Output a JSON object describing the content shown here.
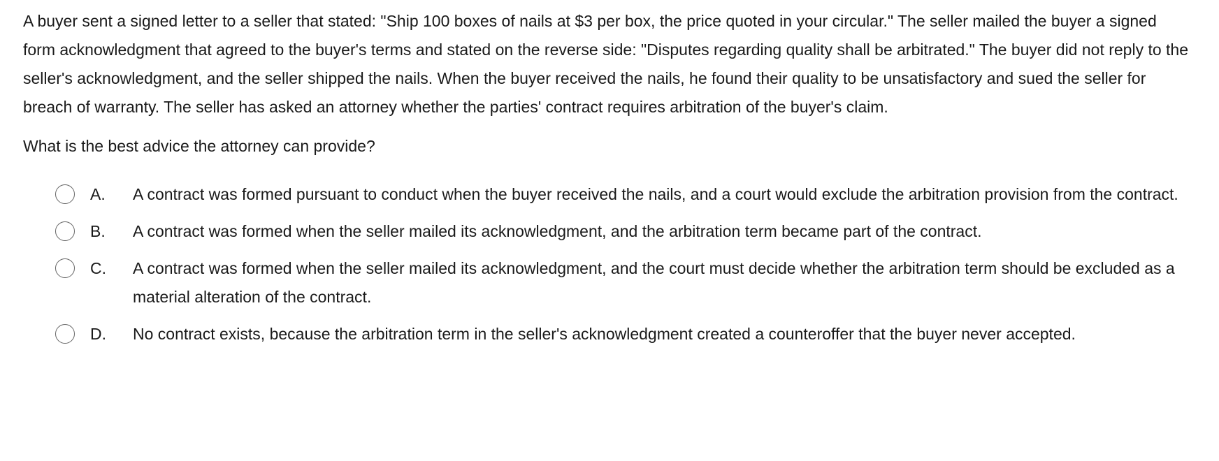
{
  "stem": "A buyer sent a signed letter to a seller that stated: \"Ship 100 boxes of nails at $3 per box, the price quoted in your circular.\"  The seller mailed the buyer a signed form acknowledgment that agreed to the buyer's terms and stated on the reverse side: \"Disputes regarding quality shall be arbitrated.\"  The buyer did not reply to the seller's acknowledgment, and the seller shipped the nails.  When the buyer received the nails, he found their quality to be unsatisfactory and sued the seller for breach of warranty.  The seller has asked an attorney whether the parties' contract requires arbitration of the buyer's claim.",
  "question": "What is the best advice the attorney can provide?",
  "choices": [
    {
      "letter": "A.",
      "text": "A contract was formed pursuant to conduct when the buyer received the nails, and a court would exclude the arbitration provision from the contract."
    },
    {
      "letter": "B.",
      "text": "A contract was formed when the seller mailed its acknowledgment, and the arbitration term became part of the contract."
    },
    {
      "letter": "C.",
      "text": "A contract was formed when the seller mailed its acknowledgment, and the court must decide whether the arbitration term should be excluded as a material alteration of the contract."
    },
    {
      "letter": "D.",
      "text": "No contract exists, because the arbitration term in the seller's acknowledgment created a counteroffer that the buyer never accepted."
    }
  ]
}
